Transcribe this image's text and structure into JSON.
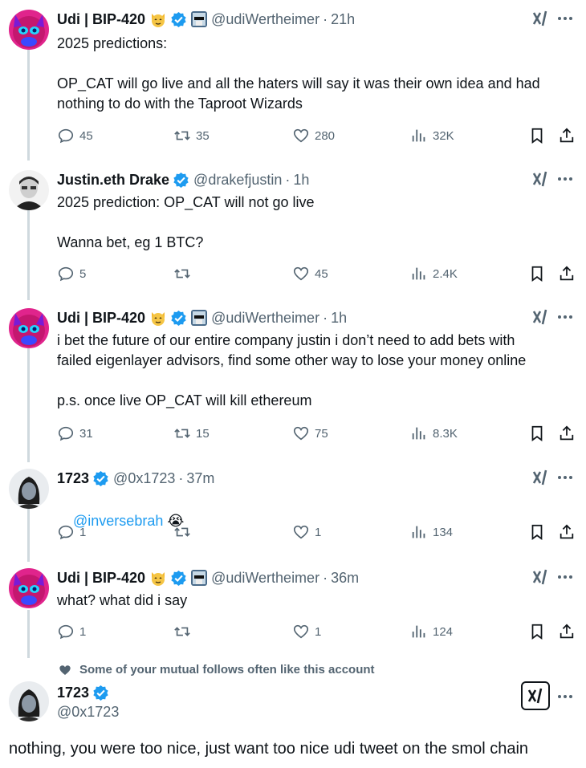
{
  "tweets": [
    {
      "name": "Udi | BIP-420",
      "handle": "@udiWertheimer",
      "time": "21h",
      "text": "2025 predictions:\n\nOP_CAT will go live and all the haters will say it was their own idea and had\nnothing to do with the Taproot Wizards",
      "replies": "45",
      "reposts": "35",
      "likes": "280",
      "views": "32K"
    },
    {
      "name": "Justin.eth Drake",
      "handle": "@drakefjustin",
      "time": "1h",
      "text": "2025 prediction: OP_CAT will not go live\n\nWanna bet, eg 1 BTC?",
      "replies": "5",
      "reposts": "",
      "likes": "45",
      "views": "2.4K"
    },
    {
      "name": "Udi | BIP-420",
      "handle": "@udiWertheimer",
      "time": "1h",
      "text": "i bet the future of our entire company justin i don’t need to add bets with\nfailed eigenlayer advisors, find some other way to lose your money online\n\np.s. once live OP_CAT will kill ethereum",
      "replies": "31",
      "reposts": "15",
      "likes": "75",
      "views": "8.3K"
    },
    {
      "name": "1723",
      "handle": "@0x1723",
      "time": "37m",
      "mention": "@inversebrah",
      "emoji": "😭",
      "replies": "1",
      "reposts": "",
      "likes": "1",
      "views": "134"
    },
    {
      "name": "Udi | BIP-420",
      "handle": "@udiWertheimer",
      "time": "36m",
      "text": "what? what did i say",
      "replies": "1",
      "reposts": "",
      "likes": "1",
      "views": "124"
    }
  ],
  "social_context": "Some of your mutual follows often like this account",
  "focused": {
    "name": "1723",
    "handle": "@0x1723",
    "text": "nothing, you were too nice, just want too nice udi tweet on the smol chain"
  },
  "separator": "·",
  "colors": {
    "verified": "#1d9bf0",
    "muted": "#536471",
    "text": "#0f1419",
    "link": "#1d9bf0",
    "line": "#cfd9de"
  },
  "icons": [
    "reply-icon",
    "repost-icon",
    "like-icon",
    "views-icon",
    "bookmark-icon",
    "share-icon",
    "grok-icon",
    "more-icon",
    "verified-icon",
    "heart-filled-icon"
  ]
}
